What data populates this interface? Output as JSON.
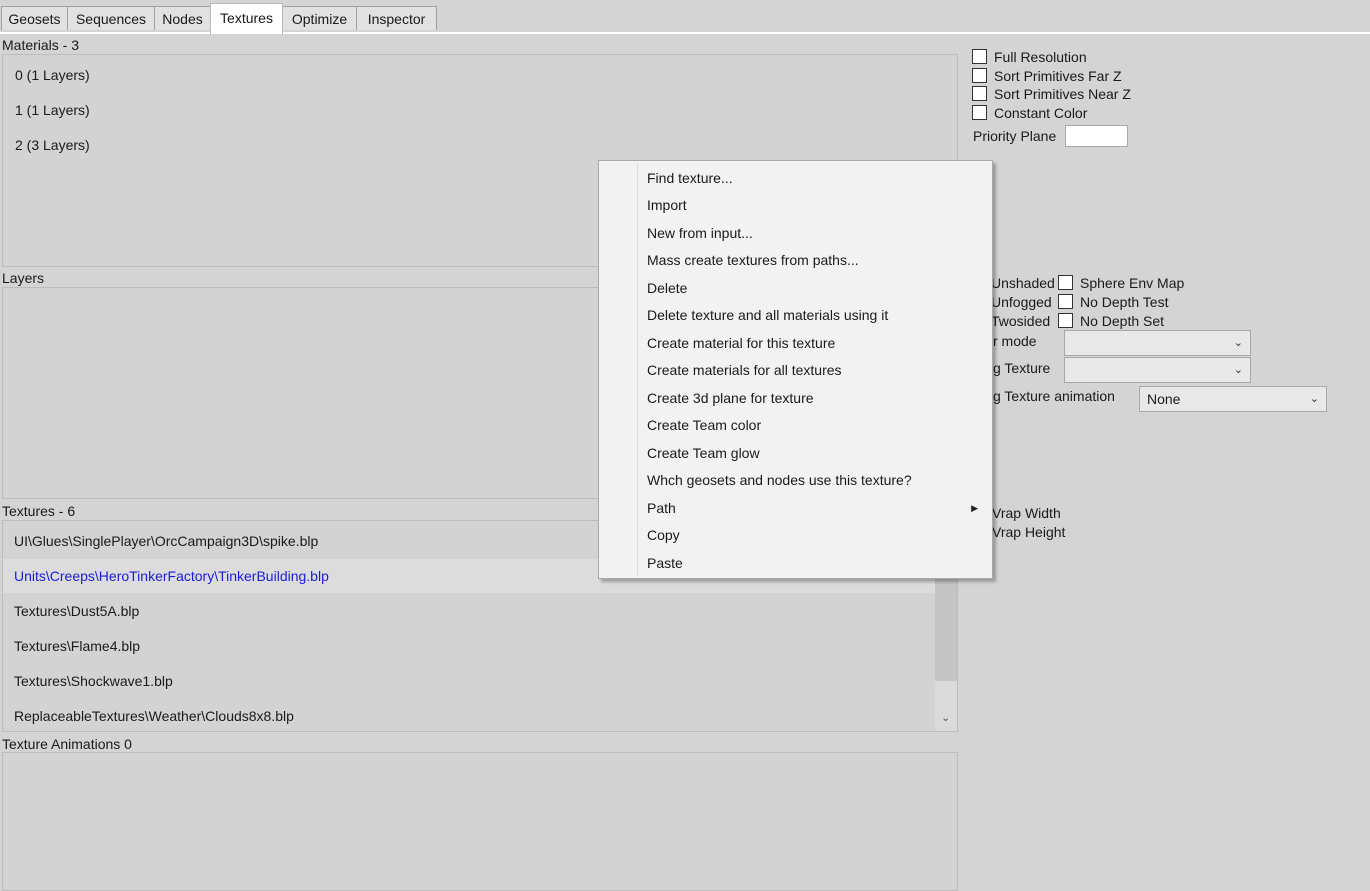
{
  "tabs": [
    {
      "label": "Geosets",
      "active": false
    },
    {
      "label": "Sequences",
      "active": false
    },
    {
      "label": "Nodes",
      "active": false
    },
    {
      "label": "Textures",
      "active": true
    },
    {
      "label": "Optimize",
      "active": false
    },
    {
      "label": "Inspector",
      "active": false
    }
  ],
  "materials": {
    "header": "Materials - 3",
    "items": [
      "0 (1 Layers)",
      "1 (1 Layers)",
      "2 (3 Layers)"
    ]
  },
  "layers": {
    "header": "Layers"
  },
  "textures": {
    "header": "Textures - 6",
    "selected_index": 1,
    "items": [
      "UI\\Glues\\SinglePlayer\\OrcCampaign3D\\spike.blp",
      "Units\\Creeps\\HeroTinkerFactory\\TinkerBuilding.blp",
      "Textures\\Dust5A.blp",
      "Textures\\Flame4.blp",
      "Textures\\Shockwave1.blp",
      "ReplaceableTextures\\Weather\\Clouds8x8.blp"
    ]
  },
  "texture_animations": {
    "header": "Texture Animations 0"
  },
  "material_props": {
    "checkboxes": [
      "Full Resolution",
      "Sort Primitives Far Z",
      "Sort Primitives Near Z",
      "Constant Color"
    ],
    "priority_plane_label": "Priority Plane",
    "priority_plane_value": ""
  },
  "layer_props": {
    "flags_left": [
      "Unshaded",
      "Unfogged",
      "Twosided"
    ],
    "flags_right": [
      "Sphere Env Map",
      "No Depth Test",
      "No Depth Set"
    ],
    "filter_mode_label": "r mode",
    "filter_mode_value": "",
    "texture_label": "g Texture",
    "texture_value": "",
    "texture_anim_label": "g Texture animation",
    "texture_anim_value": "None"
  },
  "texture_props": {
    "wrap_width": "Vrap Width",
    "wrap_height": "Vrap Height"
  },
  "context_menu": {
    "items": [
      {
        "label": "Find texture..."
      },
      {
        "label": "Import"
      },
      {
        "label": "New from input..."
      },
      {
        "label": "Mass create textures from paths..."
      },
      {
        "label": "Delete"
      },
      {
        "label": "Delete texture and all materials using it"
      },
      {
        "label": "Create material for this texture"
      },
      {
        "label": "Create materials for all textures"
      },
      {
        "label": "Create 3d plane for texture"
      },
      {
        "label": "Create Team color"
      },
      {
        "label": "Create Team glow"
      },
      {
        "label": "Whch geosets and nodes use this texture?"
      },
      {
        "label": "Path",
        "submenu": true
      },
      {
        "label": "Copy"
      },
      {
        "label": "Paste"
      }
    ]
  },
  "icons": {
    "dropdown": "chevron-down-icon",
    "submenu": "triangle-right-icon",
    "scroll_down": "chevron-down-icon"
  }
}
